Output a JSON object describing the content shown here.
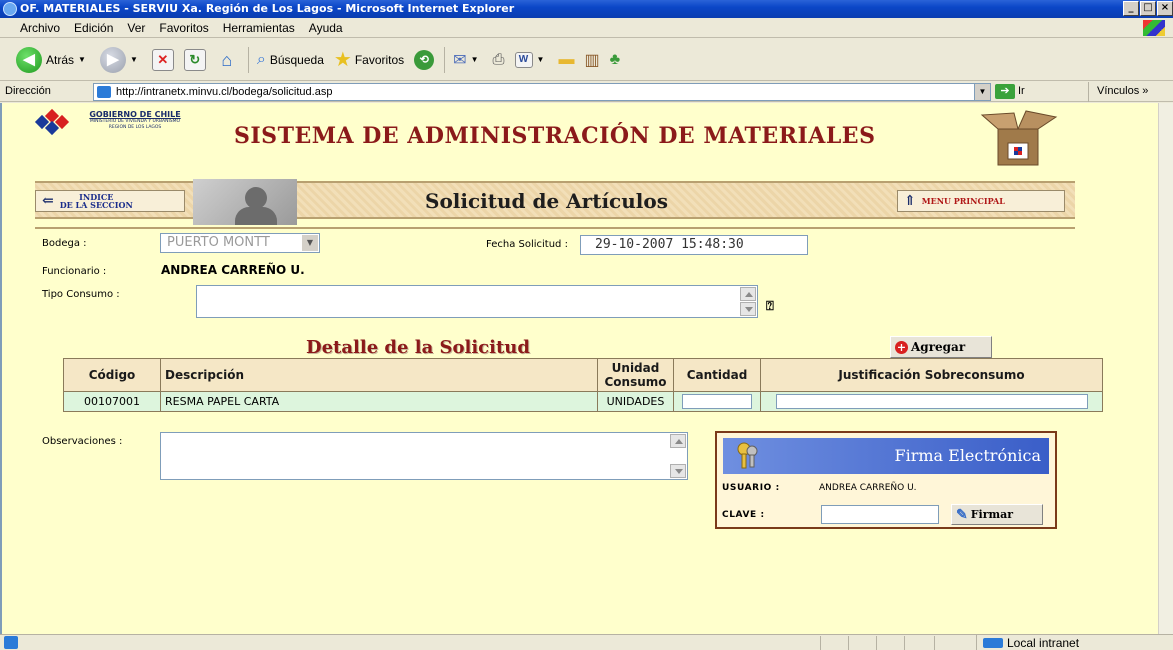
{
  "window": {
    "title": "OF. MATERIALES - SERVIU Xa. Región de Los Lagos - Microsoft Internet Explorer",
    "min": "_",
    "max": "□",
    "close": "×"
  },
  "menu": [
    "Archivo",
    "Edición",
    "Ver",
    "Favoritos",
    "Herramientas",
    "Ayuda"
  ],
  "toolbar": {
    "back": "Atrás",
    "search": "Búsqueda",
    "favorites": "Favoritos"
  },
  "address": {
    "label": "Dirección",
    "url": "http://intranetx.minvu.cl/bodega/solicitud.asp",
    "go": "Ir",
    "links": "Vínculos »"
  },
  "header": {
    "org_line1": "GOBIERNO DE CHILE",
    "org_line2": "MINISTERIO DE VIVIENDA Y URBANISMO",
    "org_line3": "REGION DE LOS LAGOS",
    "system_title": "SISTEMA DE ADMINISTRACIÓN DE MATERIALES"
  },
  "banner": {
    "index_line1": "INDICE",
    "index_line2": "DE LA SECCION",
    "title": "Solicitud de Artículos",
    "menu": "MENU PRINCIPAL"
  },
  "form": {
    "bodega_label": "Bodega :",
    "bodega_value": "PUERTO MONTT",
    "fecha_label": "Fecha Solicitud :",
    "fecha_value": "29-10-2007 15:48:30",
    "funcionario_label": "Funcionario :",
    "funcionario_value": "ANDREA CARREÑO U.",
    "tipo_label": "Tipo Consumo :",
    "observaciones_label": "Observaciones :"
  },
  "detail": {
    "title": "Detalle de la Solicitud",
    "add_label": "Agregar",
    "columns": [
      "Código",
      "Descripción",
      "Unidad Consumo",
      "Cantidad",
      "Justificación Sobreconsumo"
    ],
    "unit_col_line1": "Unidad",
    "unit_col_line2": "Consumo",
    "rows": [
      {
        "codigo": "00107001",
        "descripcion": "RESMA PAPEL CARTA",
        "unidad": "UNIDADES"
      }
    ]
  },
  "firma": {
    "title": "Firma Electrónica",
    "user_label": "USUARIO :",
    "user_value": "ANDREA CARREÑO U.",
    "pass_label": "CLAVE :",
    "button": "Firmar"
  },
  "status": {
    "zone": "Local intranet"
  },
  "colors": {
    "page_background": "#ffffcc",
    "title_red": "#8b1a1a",
    "table_header": "#f5e7c6",
    "table_row": "#ddf5dd",
    "firma_header": "#3a5ec8"
  }
}
